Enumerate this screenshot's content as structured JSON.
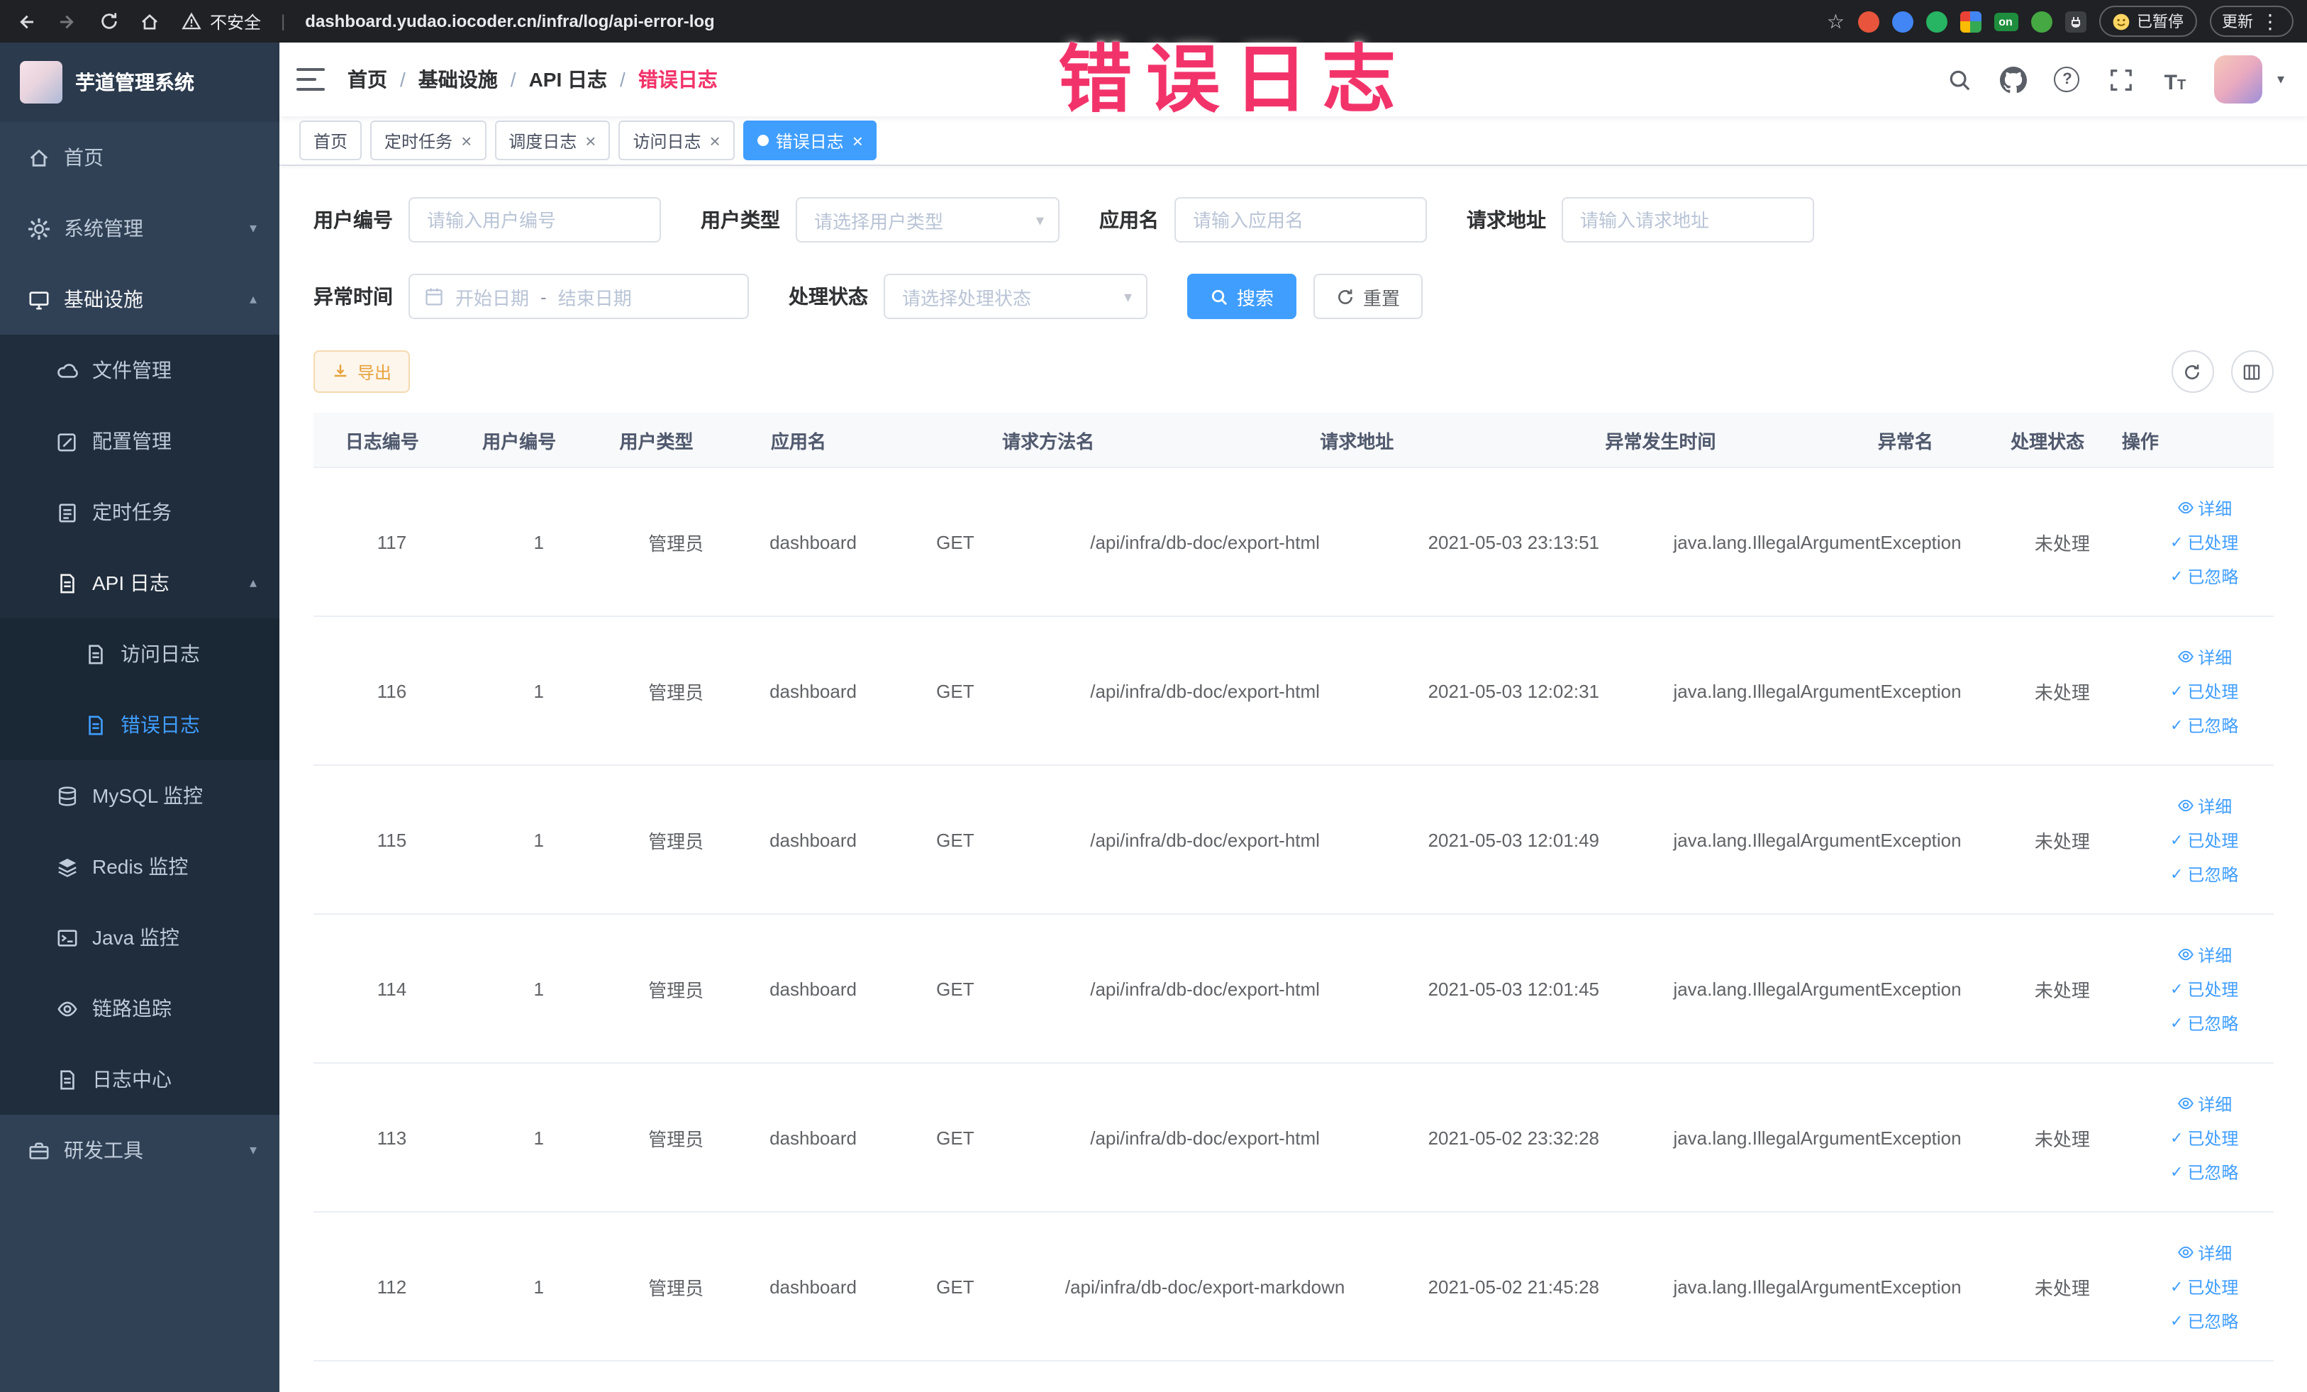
{
  "browser": {
    "security_label": "不安全",
    "url": "dashboard.yudao.iocoder.cn/infra/log/api-error-log",
    "on_badge": "on",
    "paused_badge": "已暂停",
    "update_label": "更新"
  },
  "annotation": {
    "text": "错误日志"
  },
  "sidebar": {
    "title": "芋道管理系统",
    "menu": {
      "home": "首页",
      "system": "系统管理",
      "infra": "基础设施",
      "file": "文件管理",
      "config": "配置管理",
      "job": "定时任务",
      "api_log": "API 日志",
      "access_log": "访问日志",
      "error_log": "错误日志",
      "mysql": "MySQL 监控",
      "redis": "Redis 监控",
      "java": "Java 监控",
      "trace": "链路追踪",
      "log_center": "日志中心",
      "dev": "研发工具"
    }
  },
  "header": {
    "breadcrumb": [
      "首页",
      "基础设施",
      "API 日志",
      "错误日志"
    ]
  },
  "tags": [
    {
      "label": "首页"
    },
    {
      "label": "定时任务"
    },
    {
      "label": "调度日志"
    },
    {
      "label": "访问日志"
    },
    {
      "label": "错误日志"
    }
  ],
  "filters": {
    "user_id": {
      "label": "用户编号",
      "placeholder": "请输入用户编号"
    },
    "user_type": {
      "label": "用户类型",
      "placeholder": "请选择用户类型"
    },
    "app_name": {
      "label": "应用名",
      "placeholder": "请输入应用名"
    },
    "request_url": {
      "label": "请求地址",
      "placeholder": "请输入请求地址"
    },
    "exception_time": {
      "label": "异常时间",
      "start_placeholder": "开始日期",
      "separator": "-",
      "end_placeholder": "结束日期"
    },
    "process_status": {
      "label": "处理状态",
      "placeholder": "请选择处理状态"
    },
    "search": "搜索",
    "reset": "重置"
  },
  "toolbar": {
    "export": "导出"
  },
  "table": {
    "columns": [
      "日志编号",
      "用户编号",
      "用户类型",
      "应用名",
      "请求方法名",
      "请求地址",
      "异常发生时间",
      "异常名",
      "处理状态",
      "操作"
    ],
    "actions": {
      "detail": "详细",
      "processed": "已处理",
      "ignored": "已忽略"
    },
    "rows": [
      {
        "id": "117",
        "user_id": "1",
        "user_type": "管理员",
        "app_name": "dashboard",
        "method": "GET",
        "url": "/api/infra/db-doc/export-html",
        "time": "2021-05-03 23:13:51",
        "exception": "java.lang.IllegalArgumentException",
        "status": "未处理"
      },
      {
        "id": "116",
        "user_id": "1",
        "user_type": "管理员",
        "app_name": "dashboard",
        "method": "GET",
        "url": "/api/infra/db-doc/export-html",
        "time": "2021-05-03 12:02:31",
        "exception": "java.lang.IllegalArgumentException",
        "status": "未处理"
      },
      {
        "id": "115",
        "user_id": "1",
        "user_type": "管理员",
        "app_name": "dashboard",
        "method": "GET",
        "url": "/api/infra/db-doc/export-html",
        "time": "2021-05-03 12:01:49",
        "exception": "java.lang.IllegalArgumentException",
        "status": "未处理"
      },
      {
        "id": "114",
        "user_id": "1",
        "user_type": "管理员",
        "app_name": "dashboard",
        "method": "GET",
        "url": "/api/infra/db-doc/export-html",
        "time": "2021-05-03 12:01:45",
        "exception": "java.lang.IllegalArgumentException",
        "status": "未处理"
      },
      {
        "id": "113",
        "user_id": "1",
        "user_type": "管理员",
        "app_name": "dashboard",
        "method": "GET",
        "url": "/api/infra/db-doc/export-html",
        "time": "2021-05-02 23:32:28",
        "exception": "java.lang.IllegalArgumentException",
        "status": "未处理"
      },
      {
        "id": "112",
        "user_id": "1",
        "user_type": "管理员",
        "app_name": "dashboard",
        "method": "GET",
        "url": "/api/infra/db-doc/export-markdown",
        "time": "2021-05-02 21:45:28",
        "exception": "java.lang.IllegalArgumentException",
        "status": "未处理"
      }
    ]
  }
}
